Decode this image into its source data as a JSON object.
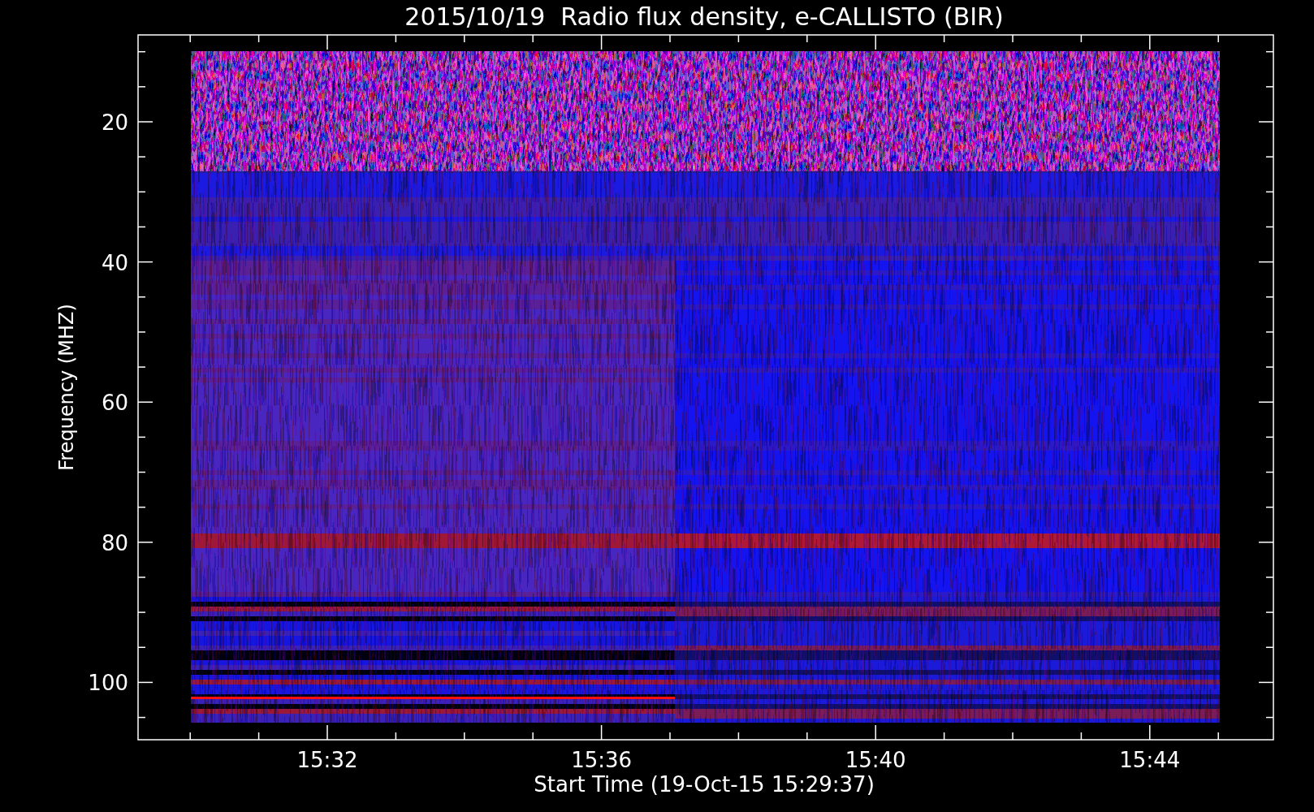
{
  "title": "2015/10/19  Radio flux density, e-CALLISTO (BIR)",
  "y_axis": {
    "label": "Frequency (MHZ)",
    "ticks": [
      "20",
      "40",
      "60",
      "80",
      "100"
    ]
  },
  "x_axis": {
    "label": "Start Time (19-Oct-15 15:29:37)",
    "ticks": [
      "15:32",
      "15:36",
      "15:40",
      "15:44"
    ]
  }
}
